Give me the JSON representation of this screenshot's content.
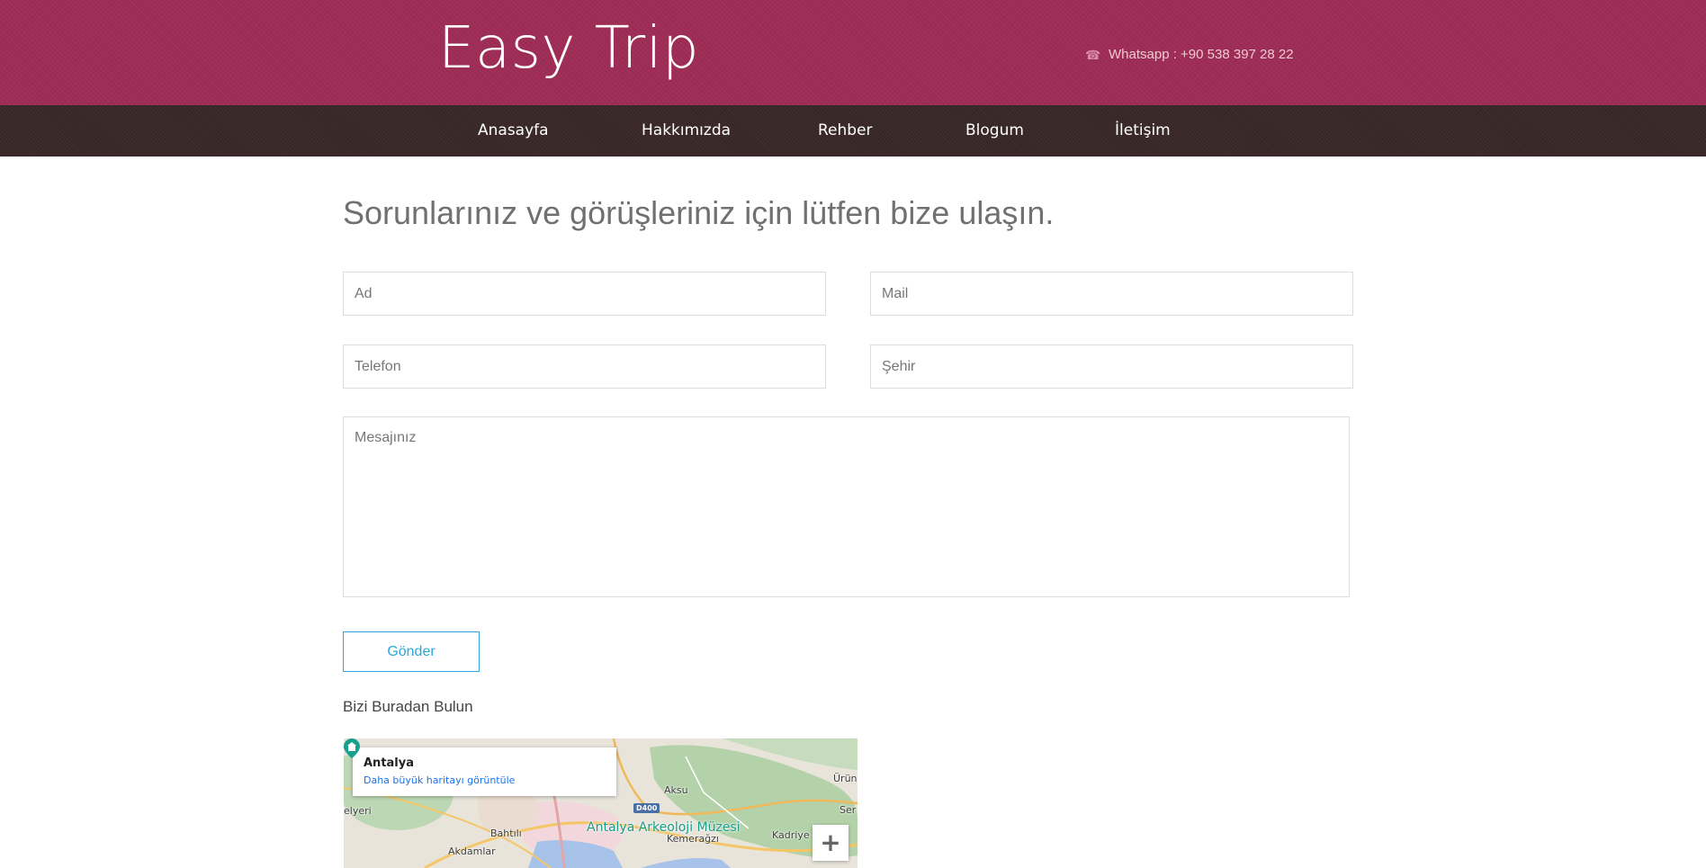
{
  "header": {
    "logo": "Easy Trip",
    "contact_text": "Whatsapp : +90 538 397 28 22",
    "phone_icon": "phone-icon",
    "color": "#9e2d55"
  },
  "nav": {
    "color": "#3a2828",
    "items": [
      {
        "label": "Anasayfa"
      },
      {
        "label": "Hakkımızda"
      },
      {
        "label": "Rehber"
      },
      {
        "label": "Blogum"
      },
      {
        "label": "İletişim"
      }
    ]
  },
  "main": {
    "heading": "Sorunlarınız ve görüşleriniz için lütfen bize ulaşın.",
    "form": {
      "name_placeholder": "Ad",
      "mail_placeholder": "Mail",
      "phone_placeholder": "Telefon",
      "city_placeholder": "Şehir",
      "message_placeholder": "Mesajınız",
      "submit_label": "Gönder",
      "accent_color": "#2ea6d9"
    },
    "find_us_label": "Bizi Buradan Bulun"
  },
  "map": {
    "card_title": "Antalya",
    "card_link": "Daha büyük haritayı görüntüle",
    "labels": {
      "aksu": "Aksu",
      "urun": "Ürün",
      "elyeri": "elyeri",
      "ser": "Ser",
      "bahtili": "Bahtılı",
      "kemeragzi": "Kemerağzı",
      "kadriye": "Kadriye",
      "akdamlar": "Akdamlar"
    },
    "poi": "Antalya Arkeoloji Müzesi",
    "road": "D400",
    "zoom_in": "+"
  }
}
